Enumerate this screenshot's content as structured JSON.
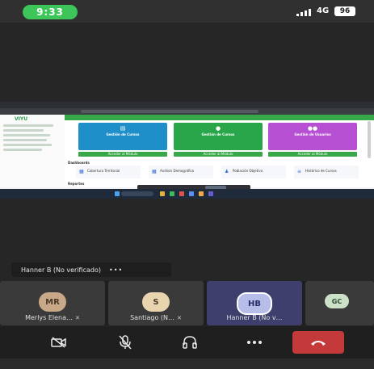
{
  "status": {
    "time": "9:33",
    "network": "4G",
    "battery": "96"
  },
  "shared_screen": {
    "app_logo": "VIYU",
    "cards": [
      {
        "title": "Gestión de Cursos",
        "button": "Acceder al Módulo",
        "color": "#1f8fc9"
      },
      {
        "title": "Gestión de Cursos",
        "button": "Acceder al Módulo",
        "color": "#2aa64a"
      },
      {
        "title": "Gestión de Usuarios",
        "button": "Acceder al Módulo",
        "color": "#b64fd1"
      }
    ],
    "dashboard_label": "Dashboards",
    "dashboard_items": [
      "Cobertura Territorial",
      "Análisis Demográfico",
      "Población Objetivo",
      "Histórico de Cursos"
    ],
    "reports_label": "Reportes"
  },
  "speaker": {
    "name": "Hanner B (No verificado)",
    "more": "•••"
  },
  "participants": [
    {
      "initials": "MR",
      "name": "Merlys Elena…",
      "avatar_color": "#c9a889"
    },
    {
      "initials": "S",
      "name": "Santiago (N…",
      "avatar_color": "#e9d4b0"
    },
    {
      "initials": "HB",
      "name": "Hanner B (No v…",
      "avatar_color": "#b6bde8"
    },
    {
      "initials": "GC",
      "name": "",
      "avatar_color": "#cde1c9"
    }
  ],
  "toolbar": {
    "camera_icon": "camera-off-icon",
    "mic_icon": "mic-off-icon",
    "audio_icon": "headphones-icon",
    "more_icon": "more-icon",
    "end_icon": "end-call-icon",
    "end_color": "#c43a3a"
  }
}
